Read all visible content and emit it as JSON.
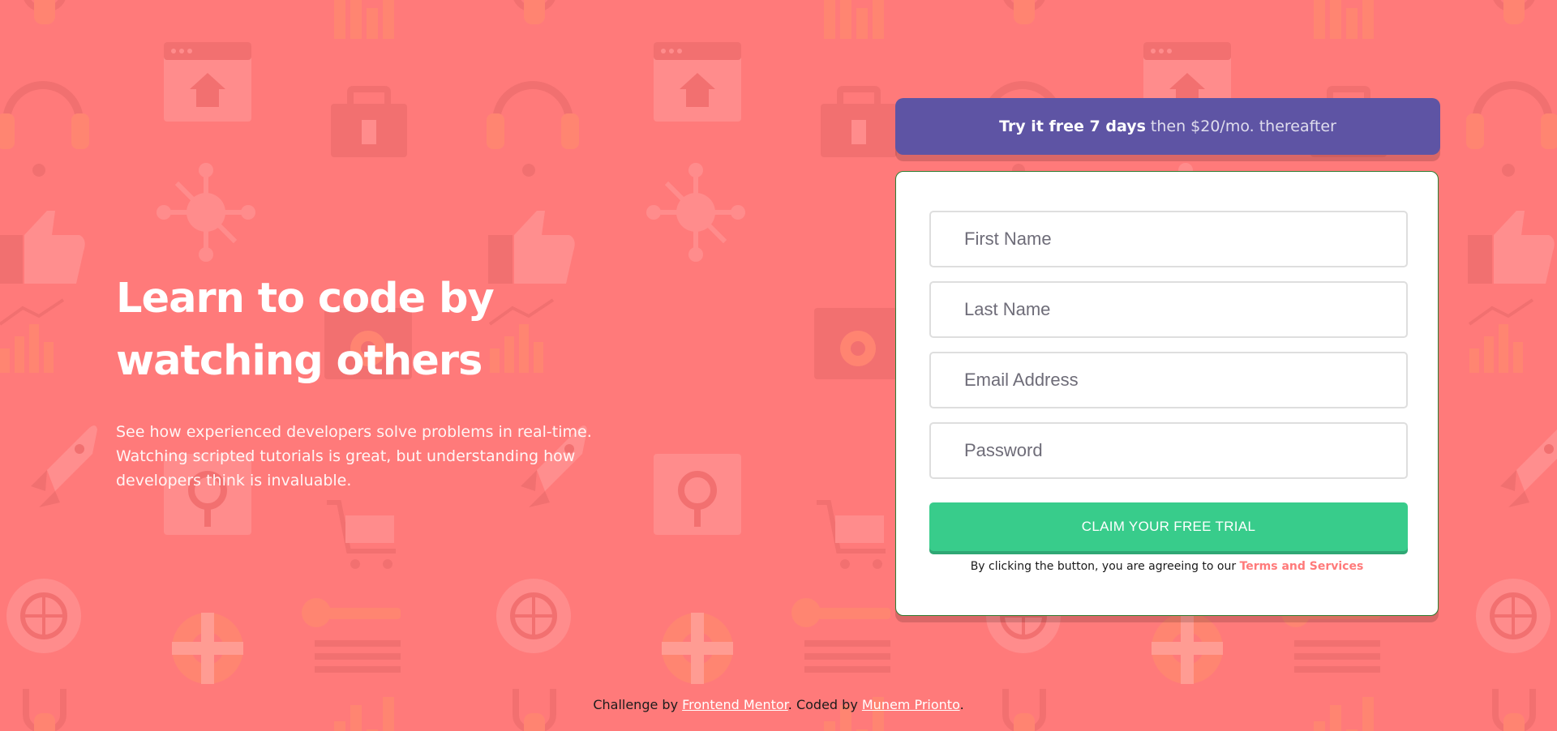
{
  "theme": {
    "background": "#FF7A7A",
    "promo_color": "#5E54A4",
    "cta_color": "#38CC8B",
    "terms_link_color": "#FF7A7A"
  },
  "hero": {
    "title": "Learn to code by watching others",
    "description": "See how experienced developers solve problems in real-time. Watching scripted tutorials is great, but understanding how developers think is invaluable."
  },
  "promo": {
    "strong": "Try it free 7 days",
    "light": "then $20/mo. thereafter"
  },
  "form": {
    "first_name_placeholder": "First Name",
    "last_name_placeholder": "Last Name",
    "email_placeholder": "Email Address",
    "password_placeholder": "Password",
    "submit_label": "CLAIM YOUR FREE TRIAL",
    "terms_prefix": "By clicking the button, you are agreeing to our",
    "terms_link": "Terms and Services"
  },
  "footer": {
    "prefix": "Challenge by",
    "link1": "Frontend Mentor",
    "middle": ". Coded by",
    "link2": "Munem Prionto",
    "suffix": "."
  },
  "background_icons": [
    "browser-window-icon",
    "home-icon",
    "headset-icon",
    "toolbox-icon",
    "network-icon",
    "thumbs-up-icon",
    "bar-chart-icon",
    "gear-icon",
    "rocket-icon",
    "magnifier-icon",
    "shopping-cart-icon",
    "key-icon",
    "globe-gear-icon",
    "lifebuoy-icon",
    "calendar-icon",
    "chain-link-icon"
  ]
}
